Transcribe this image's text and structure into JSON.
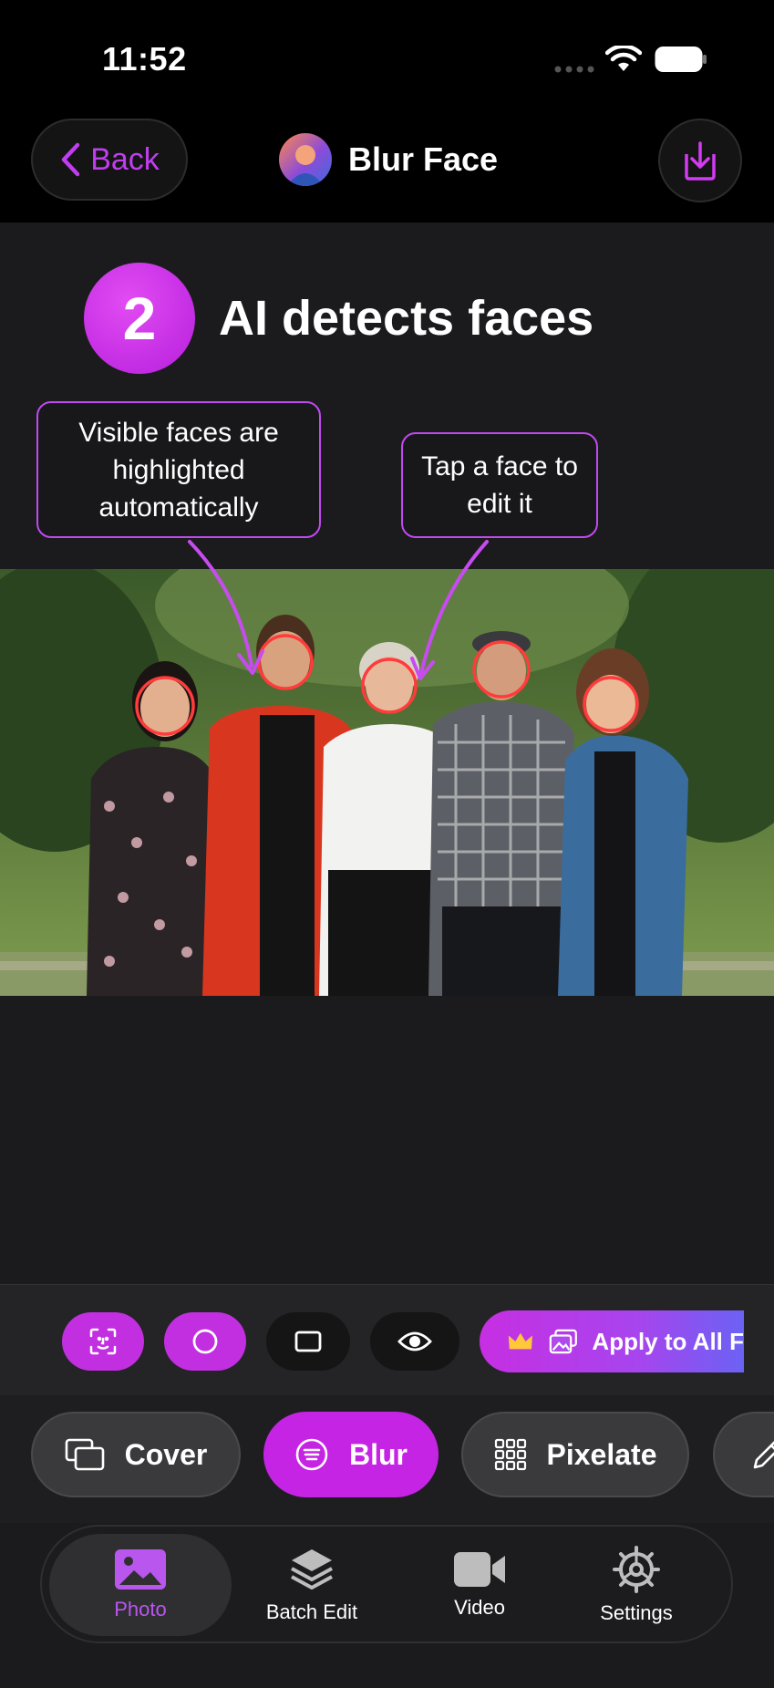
{
  "status_bar": {
    "time": "11:52"
  },
  "nav": {
    "back_label": "Back",
    "title": "Blur Face"
  },
  "step": {
    "number": "2",
    "title": "AI detects faces"
  },
  "callouts": {
    "left": "Visible faces are highlighted automatically",
    "right": "Tap a face to edit it"
  },
  "tools": {
    "apply_all_label": "Apply to All F",
    "icons": [
      "face-scan-icon",
      "circle-shape-icon",
      "rectangle-shape-icon",
      "eye-icon"
    ]
  },
  "modes": [
    {
      "label": "Cover",
      "icon": "cover-icon",
      "active": false
    },
    {
      "label": "Blur",
      "icon": "blur-icon",
      "active": true
    },
    {
      "label": "Pixelate",
      "icon": "pixelate-icon",
      "active": false
    }
  ],
  "tabs": [
    {
      "label": "Photo",
      "icon": "photo-icon",
      "active": true
    },
    {
      "label": "Batch Edit",
      "icon": "layers-icon",
      "active": false
    },
    {
      "label": "Video",
      "icon": "video-icon",
      "active": false
    },
    {
      "label": "Settings",
      "icon": "gear-icon",
      "active": false
    }
  ],
  "colors": {
    "accent": "#c22fe0",
    "face_ring": "#ff3b3b",
    "background": "#1b1b1d"
  }
}
